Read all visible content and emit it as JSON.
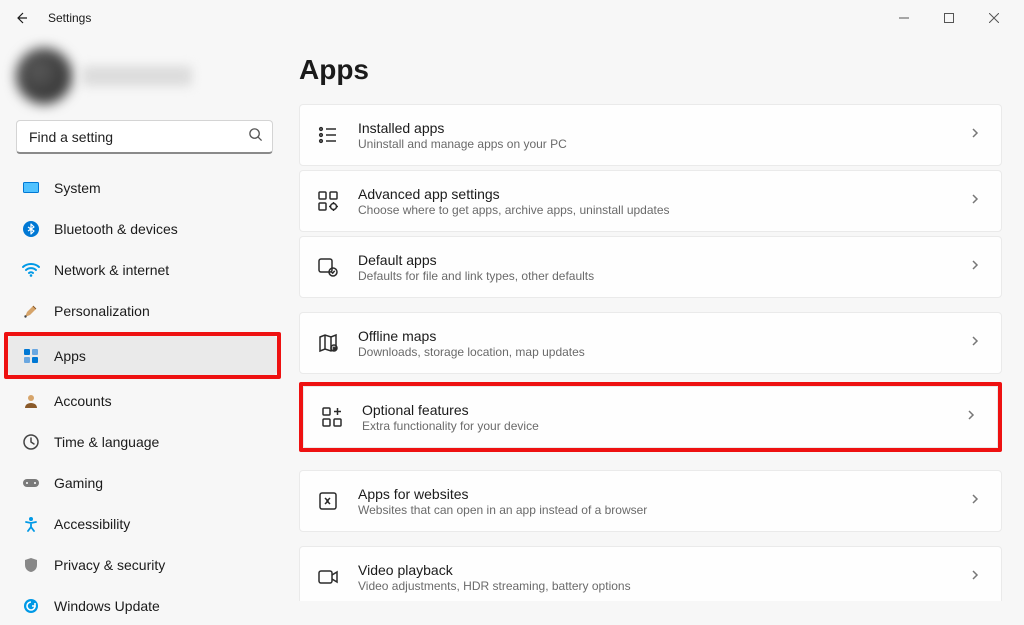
{
  "window": {
    "title": "Settings"
  },
  "sidebar": {
    "search_placeholder": "Find a setting",
    "items": [
      {
        "label": "System"
      },
      {
        "label": "Bluetooth & devices"
      },
      {
        "label": "Network & internet"
      },
      {
        "label": "Personalization"
      },
      {
        "label": "Apps"
      },
      {
        "label": "Accounts"
      },
      {
        "label": "Time & language"
      },
      {
        "label": "Gaming"
      },
      {
        "label": "Accessibility"
      },
      {
        "label": "Privacy & security"
      },
      {
        "label": "Windows Update"
      }
    ],
    "selected_index": 4,
    "highlighted_index": 4
  },
  "main": {
    "title": "Apps",
    "items": [
      {
        "title": "Installed apps",
        "subtitle": "Uninstall and manage apps on your PC"
      },
      {
        "title": "Advanced app settings",
        "subtitle": "Choose where to get apps, archive apps, uninstall updates"
      },
      {
        "title": "Default apps",
        "subtitle": "Defaults for file and link types, other defaults"
      },
      {
        "title": "Offline maps",
        "subtitle": "Downloads, storage location, map updates"
      },
      {
        "title": "Optional features",
        "subtitle": "Extra functionality for your device"
      },
      {
        "title": "Apps for websites",
        "subtitle": "Websites that can open in an app instead of a browser"
      },
      {
        "title": "Video playback",
        "subtitle": "Video adjustments, HDR streaming, battery options"
      }
    ],
    "highlighted_index": 4
  }
}
